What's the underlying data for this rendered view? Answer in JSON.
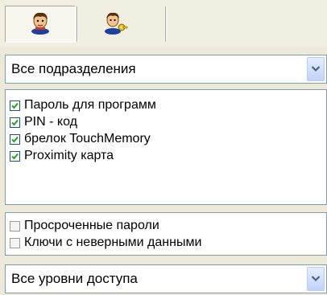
{
  "toolbar": {
    "buttons": [
      {
        "icon": "user-icon",
        "pressed": true
      },
      {
        "icon": "user-key-icon",
        "pressed": false
      }
    ]
  },
  "department_filter": {
    "selected": "Все подразделения",
    "arrow_icon": "chevron-down-icon"
  },
  "credential_types": {
    "items": [
      {
        "label": "Пароль для программ",
        "checked": true
      },
      {
        "label": "PIN - код",
        "checked": true
      },
      {
        "label": "брелок TouchMemory",
        "checked": true
      },
      {
        "label": "Proximity карта",
        "checked": true
      }
    ]
  },
  "filters": {
    "items": [
      {
        "label": "Просроченные пароли",
        "checked": false
      },
      {
        "label": "Ключи с неверными данными",
        "checked": false
      }
    ]
  },
  "access_level_filter": {
    "selected": "Все уровни доступа",
    "arrow_icon": "chevron-down-icon"
  },
  "colors": {
    "face": "#ece9d8",
    "border": "#7f9db9",
    "check": "#21a121"
  }
}
